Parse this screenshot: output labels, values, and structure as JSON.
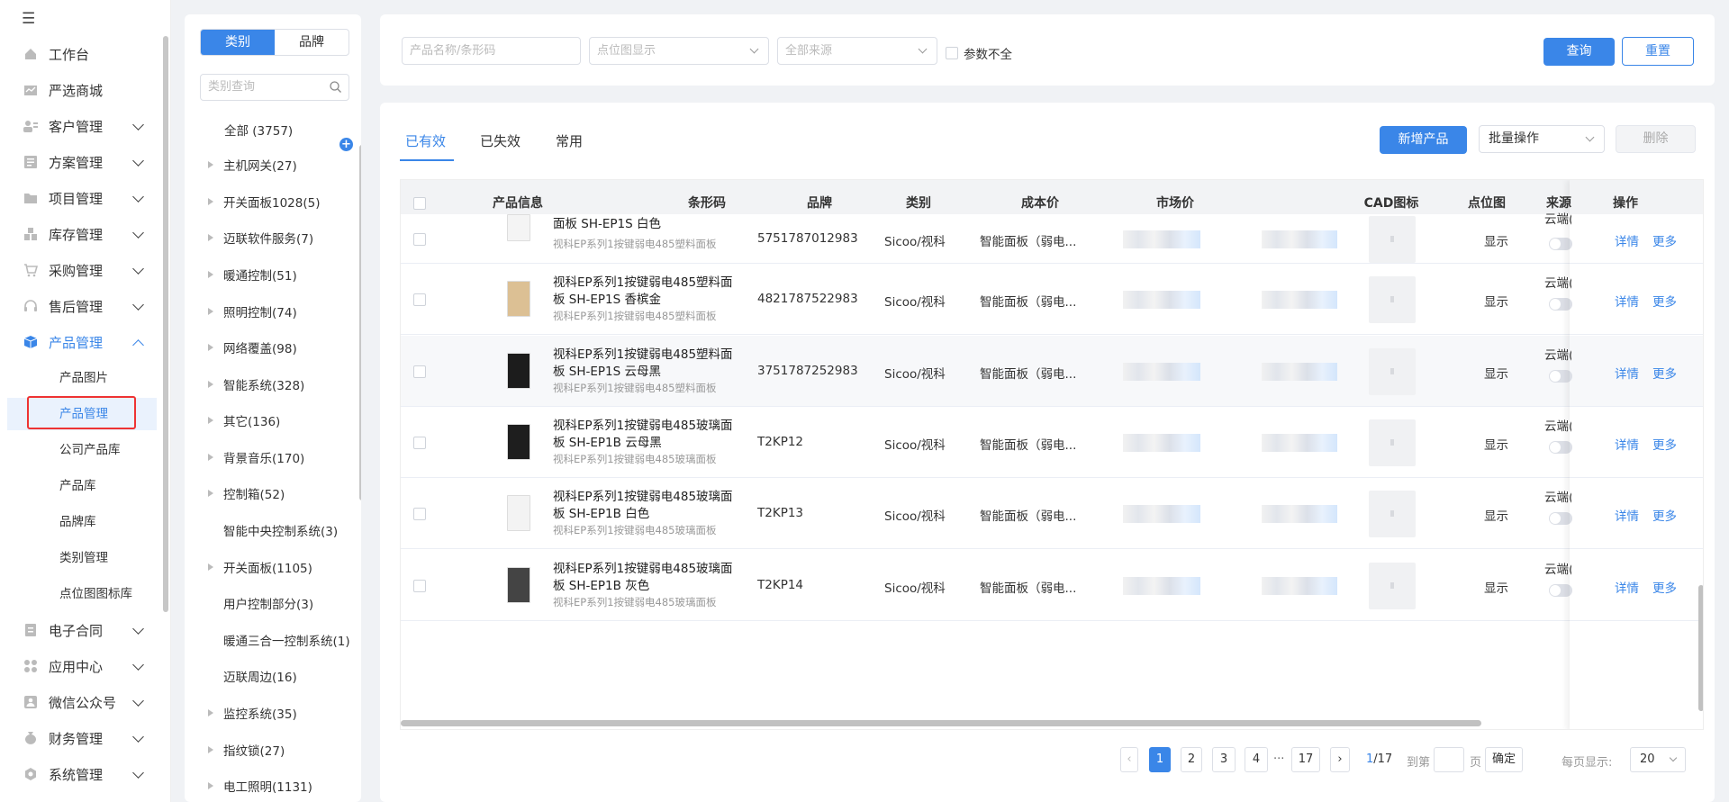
{
  "sidebar": {
    "items": [
      {
        "label": "工作台",
        "icon": "home-icon"
      },
      {
        "label": "严选商城",
        "icon": "mall-icon"
      },
      {
        "label": "客户管理",
        "icon": "customer-icon"
      },
      {
        "label": "方案管理",
        "icon": "plan-icon"
      },
      {
        "label": "项目管理",
        "icon": "folder-icon"
      },
      {
        "label": "库存管理",
        "icon": "inventory-icon"
      },
      {
        "label": "采购管理",
        "icon": "cart-icon"
      },
      {
        "label": "售后管理",
        "icon": "headset-icon"
      },
      {
        "label": "产品管理",
        "icon": "box-icon"
      },
      {
        "label": "电子合同",
        "icon": "contract-icon"
      },
      {
        "label": "应用中心",
        "icon": "apps-icon"
      },
      {
        "label": "微信公众号",
        "icon": "wechat-icon"
      },
      {
        "label": "财务管理",
        "icon": "finance-icon"
      },
      {
        "label": "系统管理",
        "icon": "settings-icon"
      }
    ],
    "product_sub": [
      "产品图片",
      "产品管理",
      "公司产品库",
      "产品库",
      "品牌库",
      "类别管理",
      "点位图图标库"
    ]
  },
  "categories": {
    "tabs": [
      "类别",
      "品牌"
    ],
    "search_placeholder": "类别查询",
    "all_label": "全部 (3757)",
    "items": [
      "主机网关(27)",
      "开关面板1028(5)",
      "迈联软件服务(7)",
      "暖通控制(51)",
      "照明控制(74)",
      "网络覆盖(98)",
      "智能系统(328)",
      "其它(136)",
      "背景音乐(170)",
      "控制箱(52)",
      "智能中央控制系统(3)",
      "开关面板(1105)",
      "用户控制部分(3)",
      "暖通三合一控制系统(1)",
      "迈联周边(16)",
      "监控系统(35)",
      "指纹锁(27)",
      "电工照明(1131)"
    ]
  },
  "filter": {
    "name_placeholder": "产品名称/条形码",
    "display_placeholder": "点位图显示",
    "source_placeholder": "全部来源",
    "incomplete_label": "参数不全",
    "query_label": "查询",
    "reset_label": "重置"
  },
  "main": {
    "tabs": [
      "已有效",
      "已失效",
      "常用"
    ],
    "add_label": "新增产品",
    "batch_label": "批量操作",
    "delete_label": "删除",
    "columns": [
      "产品信息",
      "条形码",
      "品牌",
      "类别",
      "成本价",
      "市场价",
      "CAD图标",
      "点位图",
      "来源",
      "操作"
    ],
    "rows": [
      {
        "name": "面板 SH-EP1S 白色",
        "sub": "视科EP系列1按键弱电485塑料面板",
        "barcode": "5751787012983",
        "brand": "Sicoo/视科",
        "category": "智能面板（弱电...",
        "display": "显示",
        "source": "云端(迈",
        "color": "#f4f4f4"
      },
      {
        "name": "视科EP系列1按键弱电485塑料面板 SH-EP1S 香槟金",
        "sub": "视科EP系列1按键弱电485塑料面板",
        "barcode": "4821787522983",
        "brand": "Sicoo/视科",
        "category": "智能面板（弱电...",
        "display": "显示",
        "source": "云端(迈",
        "color": "#dcc094"
      },
      {
        "name": "视科EP系列1按键弱电485塑料面板 SH-EP1S 云母黑",
        "sub": "视科EP系列1按键弱电485塑料面板",
        "barcode": "3751787252983",
        "brand": "Sicoo/视科",
        "category": "智能面板（弱电...",
        "display": "显示",
        "source": "云端(迈",
        "color": "#1c1c1c"
      },
      {
        "name": "视科EP系列1按键弱电485玻璃面板 SH-EP1B 云母黑",
        "sub": "视科EP系列1按键弱电485玻璃面板",
        "barcode": "T2KP12",
        "brand": "Sicoo/视科",
        "category": "智能面板（弱电...",
        "display": "显示",
        "source": "云端(迈",
        "color": "#1e1e1e"
      },
      {
        "name": "视科EP系列1按键弱电485玻璃面板 SH-EP1B 白色",
        "sub": "视科EP系列1按键弱电485玻璃面板",
        "barcode": "T2KP13",
        "brand": "Sicoo/视科",
        "category": "智能面板（弱电...",
        "display": "显示",
        "source": "云端(迈",
        "color": "#f3f3f3"
      },
      {
        "name": "视科EP系列1按键弱电485玻璃面板 SH-EP1B 灰色",
        "sub": "视科EP系列1按键弱电485玻璃面板",
        "barcode": "T2KP14",
        "brand": "Sicoo/视科",
        "category": "智能面板（弱电...",
        "display": "显示",
        "source": "云端(迈",
        "color": "#444444"
      }
    ],
    "detail_label": "详情",
    "more_label": "更多"
  },
  "pagination": {
    "pages": [
      "1",
      "2",
      "3",
      "4",
      "17"
    ],
    "ellipsis": "···",
    "current": "1",
    "total": "/17",
    "goto_label": "到第",
    "page_unit": "页",
    "confirm_label": "确定",
    "per_page_label": "每页显示:",
    "per_page_value": "20"
  },
  "colors": {
    "accent": "#3a86e8",
    "highlight": "#e33333"
  }
}
